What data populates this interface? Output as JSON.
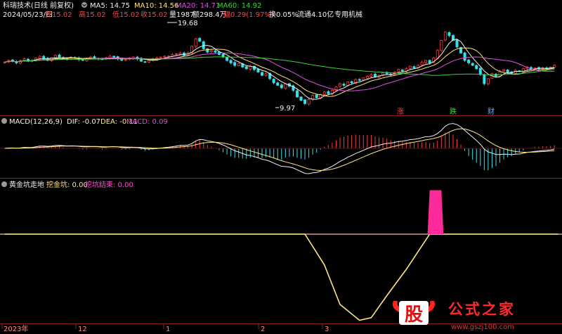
{
  "colors": {
    "bg": "#000000",
    "divider": "#8a2030",
    "grid": "#5a1020",
    "up": "#ff3a3a",
    "down": "#35e0e8",
    "white": "#f0f0f0",
    "yellow": "#ffe680",
    "purple": "#e24ee6",
    "green": "#3bd23b",
    "pink": "#ff2a9a",
    "baseline": "#ffb0b0",
    "magenta_text": "#ff4fd8"
  },
  "header": {
    "title": "科瑞技术(日线 前复权)",
    "ma5": "MA5: 14.75",
    "ma10": "MA10: 14.56",
    "ma20": "MA20: 14.71",
    "ma60": "MA60: 14.92",
    "date": "2024/05/23/四",
    "open": "开15.02",
    "high": "高15.02",
    "low": "低15.02",
    "close": "收15.02",
    "volume": "量1987",
    "amount": "额298.4万",
    "change": "幅0.29(1.97%)",
    "turnover": "换0.05%",
    "float": "流通4.10亿",
    "sector": "专用机械"
  },
  "price_panel": {
    "high_label": "19.68",
    "low_label": "9.97",
    "events": [
      "涨",
      "跌",
      "财"
    ]
  },
  "macd_panel": {
    "title": "MACD(12,26,9)",
    "dif": "DIF: -0.07",
    "dea": "DEA: -0.11",
    "macd": "MACD: 0.09"
  },
  "indicator_panel": {
    "title": "黄金坑走地",
    "golden_pit": "挖金坑: 0.00",
    "pit_end": "挖坑结束: 0.00"
  },
  "x_axis": {
    "labels": [
      "2023年",
      "12",
      "1",
      "2",
      "3"
    ]
  },
  "watermark": {
    "logo_char": "股",
    "slogan": "公式之家",
    "url": "www.gszj100.com"
  },
  "chart_data": [
    {
      "type": "candlestick",
      "title": "科瑞技术(日线 前复权)",
      "marked_high": 19.68,
      "marked_low": 9.97,
      "last": {
        "date": "2024/05/23",
        "open": 15.02,
        "high": 15.02,
        "low": 15.02,
        "close": 15.02,
        "change": 0.29,
        "change_pct": 1.97
      },
      "closes": [
        15.4,
        15.6,
        15.5,
        15.3,
        15.6,
        15.8,
        15.5,
        15.6,
        15.9,
        16.1,
        15.8,
        15.6,
        15.9,
        16.2,
        16.0,
        15.8,
        15.7,
        16.0,
        15.9,
        15.7,
        15.6,
        15.8,
        16.0,
        15.9,
        15.8,
        15.7,
        15.9,
        16.1,
        16.0,
        15.8,
        15.6,
        15.7,
        15.9,
        16.0,
        15.8,
        15.5,
        15.4,
        15.6,
        15.8,
        15.9,
        16.0,
        16.1,
        16.1,
        16.3,
        16.4,
        16.5,
        16.2,
        16.5,
        17.3,
        18.2,
        17.9,
        17.0,
        16.6,
        16.8,
        16.6,
        16.3,
        16.0,
        15.6,
        15.3,
        15.0,
        15.2,
        14.8,
        14.6,
        14.9,
        14.5,
        14.2,
        13.8,
        14.0,
        13.4,
        12.9,
        12.6,
        12.3,
        12.8,
        12.5,
        12.0,
        11.2,
        10.8,
        10.4,
        10.9,
        11.4,
        11.1,
        11.5,
        11.8,
        11.6,
        12.0,
        12.4,
        12.8,
        12.6,
        13.0,
        12.9,
        13.3,
        13.2,
        13.5,
        13.7,
        13.9,
        13.6,
        13.8,
        14.1,
        14.0,
        13.9,
        14.2,
        14.5,
        14.3,
        14.6,
        14.9,
        14.7,
        15.0,
        15.4,
        15.6,
        15.3,
        15.9,
        16.8,
        18.0,
        19.0,
        18.6,
        18.0,
        17.2,
        16.5,
        15.6,
        15.3,
        15.0,
        14.6,
        13.9,
        12.8,
        13.4,
        14.0,
        13.7,
        14.3,
        14.5,
        14.2,
        14.0,
        14.4,
        14.3,
        14.6,
        14.8,
        14.5,
        14.7,
        14.6,
        14.7,
        14.6,
        14.8,
        15.02
      ]
    },
    {
      "type": "line",
      "title": "MACD(12,26,9)",
      "latest": {
        "DIF": -0.07,
        "DEA": -0.11,
        "MACD": 0.09
      },
      "note": "DIF / DEA lines and MACD histogram computed from the close series above"
    },
    {
      "type": "line",
      "title": "黄金坑走地",
      "latest": {
        "挖金坑": 0.0,
        "挖坑结束": 0.0
      },
      "x_index": [
        0,
        77,
        82,
        86,
        91,
        94,
        98,
        103,
        109,
        112,
        115,
        120,
        142
      ],
      "values": [
        0,
        0,
        -0.35,
        -0.8,
        -0.98,
        -0.95,
        -0.7,
        -0.4,
        0,
        0,
        0,
        0,
        0
      ],
      "spike": {
        "from_index": 109,
        "to_index": 112,
        "value": 0.5
      }
    }
  ]
}
